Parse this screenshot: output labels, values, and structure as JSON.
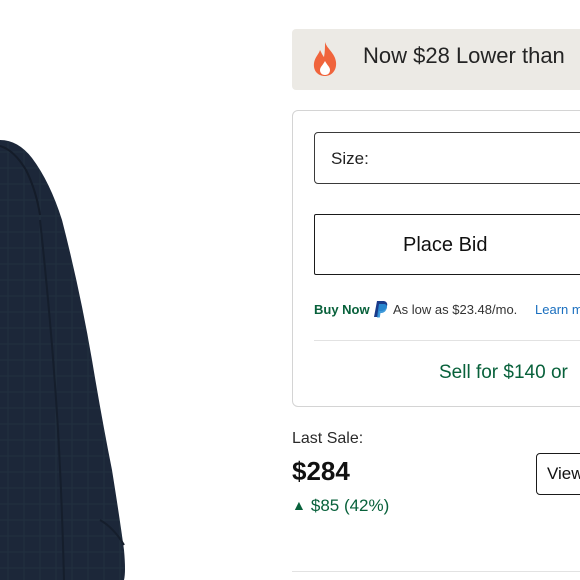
{
  "banner": {
    "icon": "fire-icon",
    "icon_color": "#f0643c",
    "text": "Now $28 Lower than"
  },
  "purchase_panel": {
    "size_select": {
      "label": "Size:"
    },
    "place_bid_label": "Place Bid",
    "buy_now": {
      "link_label": "Buy Now",
      "payment_icon": "paypal-icon",
      "installment_text": "As low as $23.48/mo.",
      "learn_more_label": "Learn m"
    },
    "sell_label": "Sell for $140 or"
  },
  "last_sale": {
    "label": "Last Sale:",
    "price": "$284",
    "change_icon": "up-triangle-icon",
    "change_text": "$85 (42%)",
    "view_button_label": "View"
  },
  "colors": {
    "accent_green": "#08613b",
    "link_blue": "#1a6fbf",
    "banner_bg": "#eceae5",
    "product_navy": "#1b2637"
  }
}
